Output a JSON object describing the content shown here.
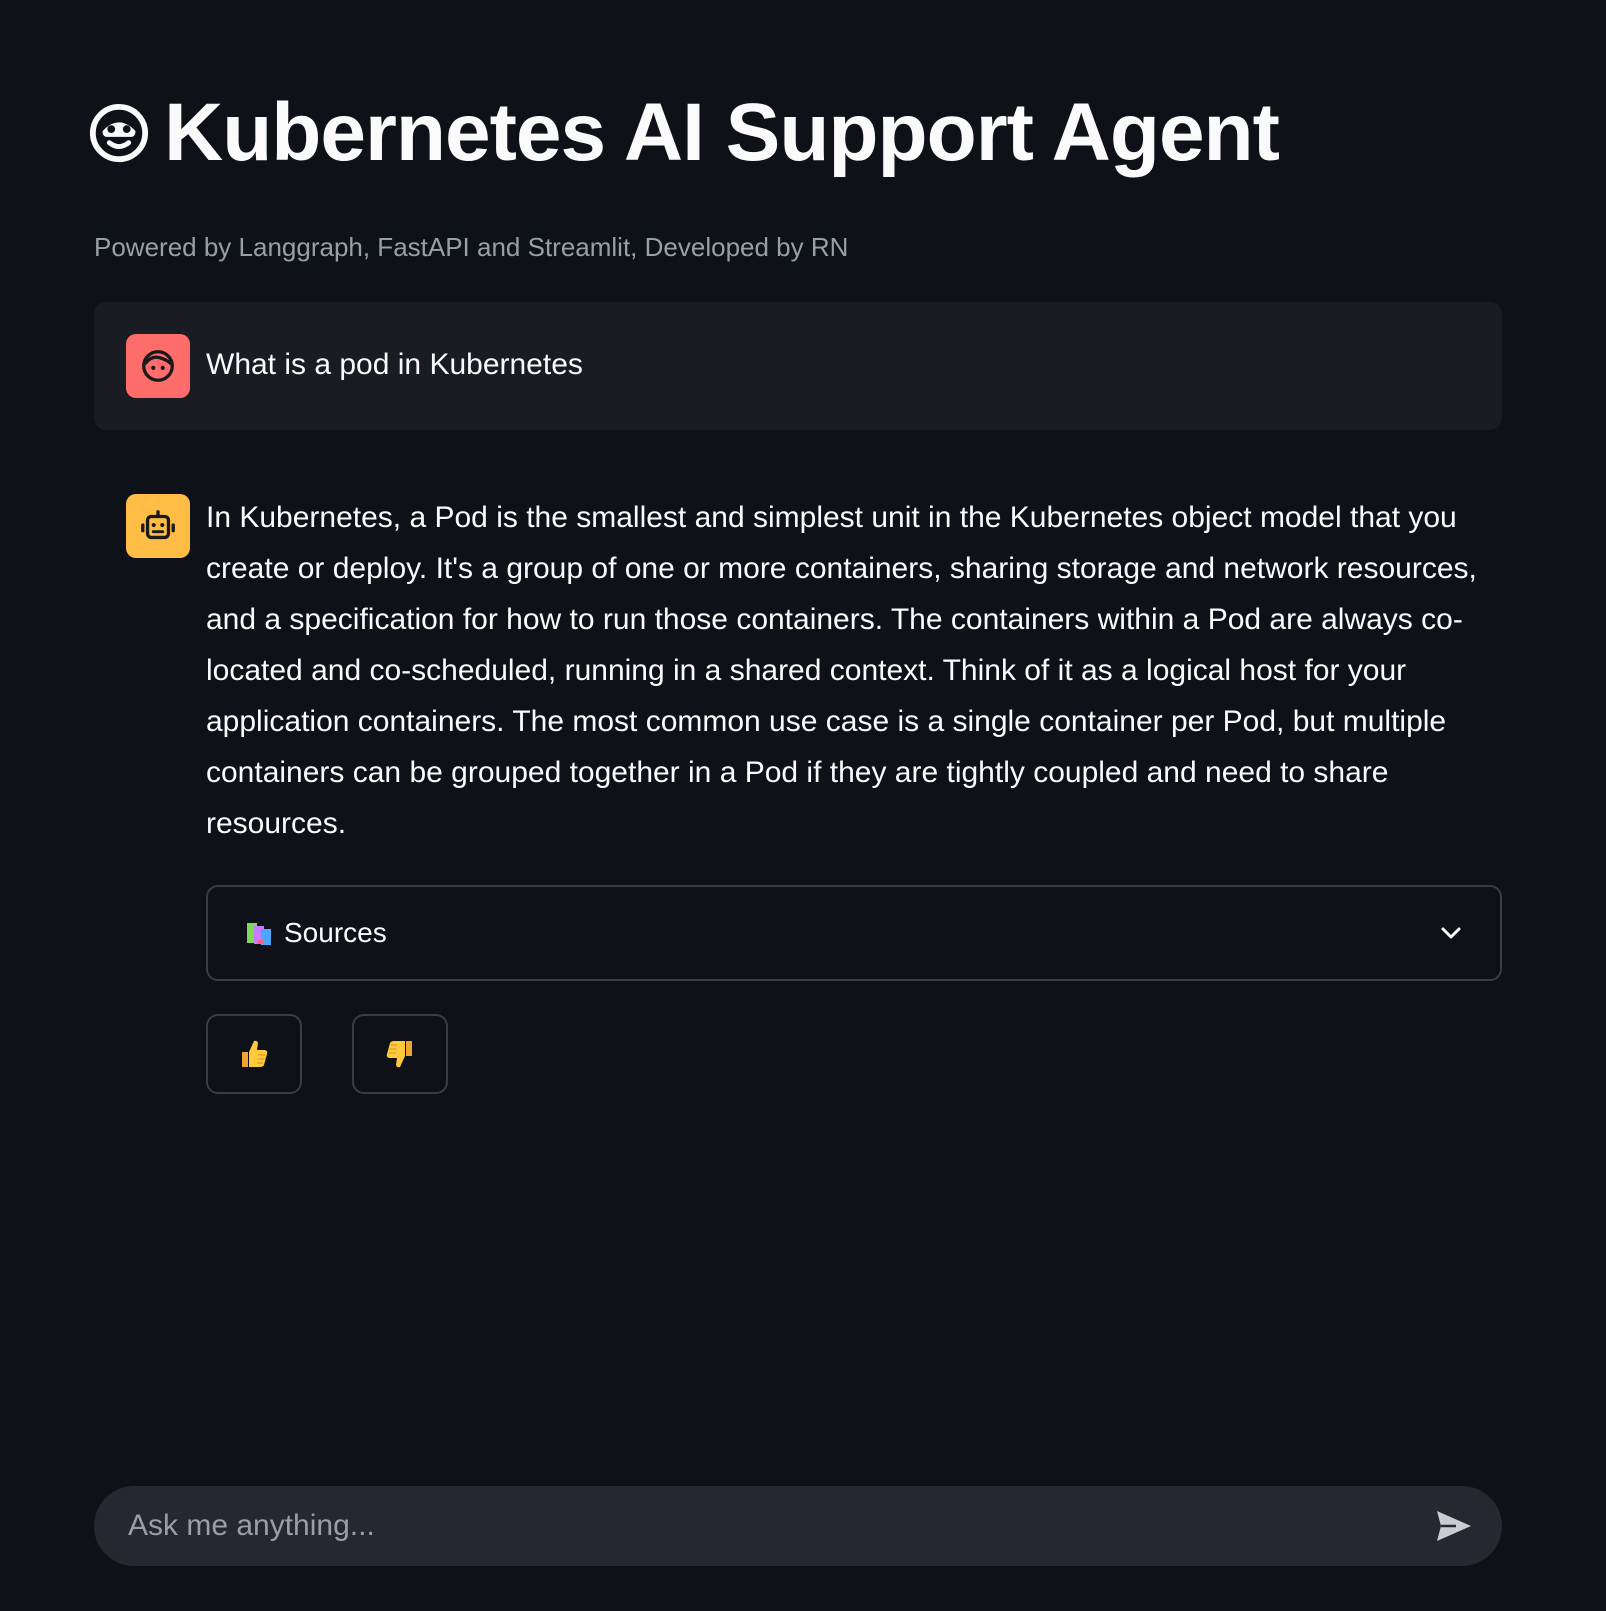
{
  "header": {
    "title": "Kubernetes AI Support Agent",
    "title_icon": "smiling-face-icon",
    "subtitle": "Powered by Langgraph, FastAPI and Streamlit, Developed by RN"
  },
  "messages": [
    {
      "role": "user",
      "avatar_icon": "user-face-icon",
      "avatar_color": "#ff6c6c",
      "text": "What is a pod in Kubernetes"
    },
    {
      "role": "assistant",
      "avatar_icon": "robot-icon",
      "avatar_color": "#ffbd45",
      "text": "In Kubernetes, a Pod is the smallest and simplest unit in the Kubernetes object model that you create or deploy. It's a group of one or more containers, sharing storage and network resources, and a specification for how to run those containers. The containers within a Pod are always co-located and co-scheduled, running in a shared context. Think of it as a logical host for your application containers. The most common use case is a single container per Pod, but multiple containers can be grouped together in a Pod if they are tightly coupled and need to share resources."
    }
  ],
  "sources_expander": {
    "icon": "books-icon",
    "label": "Sources",
    "expanded": false
  },
  "feedback": {
    "thumbs_up_icon": "thumbs-up-icon",
    "thumbs_down_icon": "thumbs-down-icon"
  },
  "chat_input": {
    "placeholder": "Ask me anything...",
    "value": "",
    "send_icon": "send-icon"
  },
  "colors": {
    "background": "#0e1117",
    "user_bubble": "#1a1c24",
    "input_bg": "#262730",
    "border": "#3a3d46"
  }
}
